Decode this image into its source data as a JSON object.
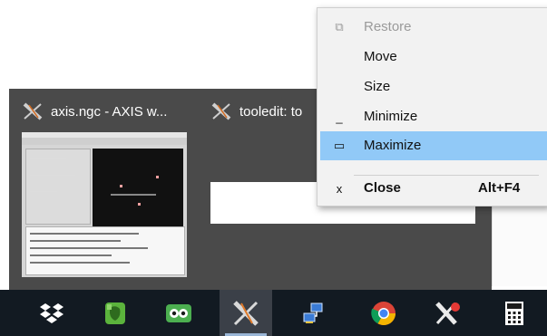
{
  "thumbnails": [
    {
      "title": "axis.ngc - AXIS w...",
      "icon": "axis-x-icon"
    },
    {
      "title": "tooledit: to",
      "icon": "axis-x-icon"
    }
  ],
  "system_menu": {
    "items": [
      {
        "label": "Restore",
        "icon": "restore-icon",
        "glyph": "⧉",
        "disabled": true,
        "accelerator": ""
      },
      {
        "label": "Move",
        "icon": "",
        "glyph": "",
        "disabled": false,
        "accelerator": ""
      },
      {
        "label": "Size",
        "icon": "",
        "glyph": "",
        "disabled": false,
        "accelerator": ""
      },
      {
        "label": "Minimize",
        "icon": "minimize-icon",
        "glyph": "_",
        "disabled": false,
        "accelerator": ""
      },
      {
        "label": "Maximize",
        "icon": "maximize-icon",
        "glyph": "▭",
        "disabled": false,
        "accelerator": "",
        "highlighted": true
      },
      {
        "label": "Close",
        "icon": "close-icon",
        "glyph": "x",
        "disabled": false,
        "accelerator": "Alt+F4",
        "bold": true
      }
    ]
  },
  "taskbar": {
    "apps": [
      {
        "name": "dropbox",
        "icon": "dropbox-icon"
      },
      {
        "name": "evernote",
        "icon": "evernote-icon"
      },
      {
        "name": "tripadvisor",
        "icon": "owl-icon"
      },
      {
        "name": "axis",
        "icon": "axis-x-icon",
        "active": true
      },
      {
        "name": "network",
        "icon": "network-icon"
      },
      {
        "name": "chrome",
        "icon": "chrome-icon"
      },
      {
        "name": "xming",
        "icon": "xming-icon"
      },
      {
        "name": "calculator",
        "icon": "calculator-icon"
      }
    ]
  },
  "colors": {
    "taskbar_bg": "#121a22",
    "preview_bg": "#4a4a4a",
    "menu_bg": "#f2f2f2",
    "menu_highlight": "#91c9f7"
  }
}
